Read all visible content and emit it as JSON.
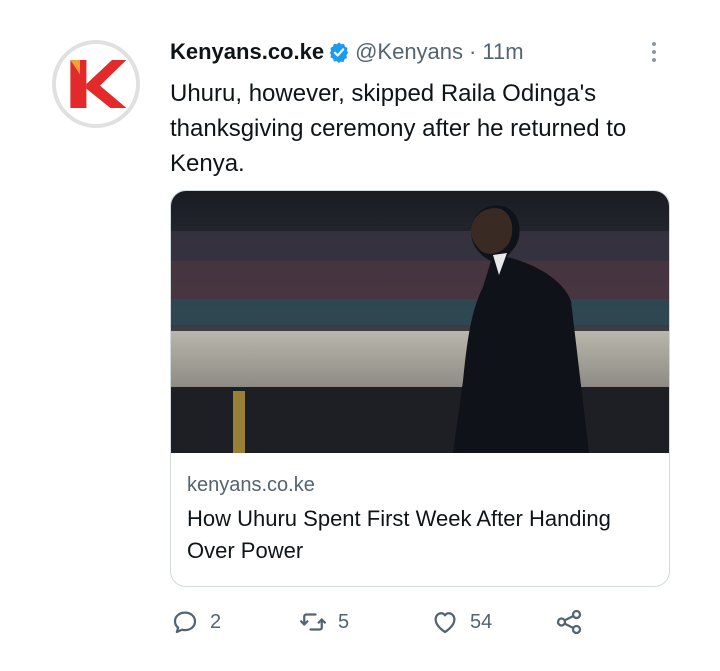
{
  "tweet": {
    "author_name": "Kenyans.co.ke",
    "handle": "@Kenyans",
    "separator": "·",
    "time": "11m",
    "text": "Uhuru, however, skipped Raila Odinga's thanksgiving ceremony after he returned to Kenya.",
    "verified": true,
    "avatar_letter": "K",
    "avatar_colors": {
      "primary": "#e22a2a",
      "secondary": "#f2a13a"
    }
  },
  "card": {
    "domain": "kenyans.co.ke",
    "title": "How Uhuru Spent First Week After Handing Over Power"
  },
  "actions": {
    "reply_count": "2",
    "retweet_count": "5",
    "like_count": "54"
  },
  "icons": {
    "verified": "verified-badge-icon",
    "more": "more-options-icon",
    "reply": "reply-icon",
    "retweet": "retweet-icon",
    "like": "heart-icon",
    "share": "share-icon"
  },
  "colors": {
    "text": "#0f1419",
    "secondary_text": "#536471",
    "verified_blue": "#1d9bf0",
    "border": "#cfd9de"
  }
}
